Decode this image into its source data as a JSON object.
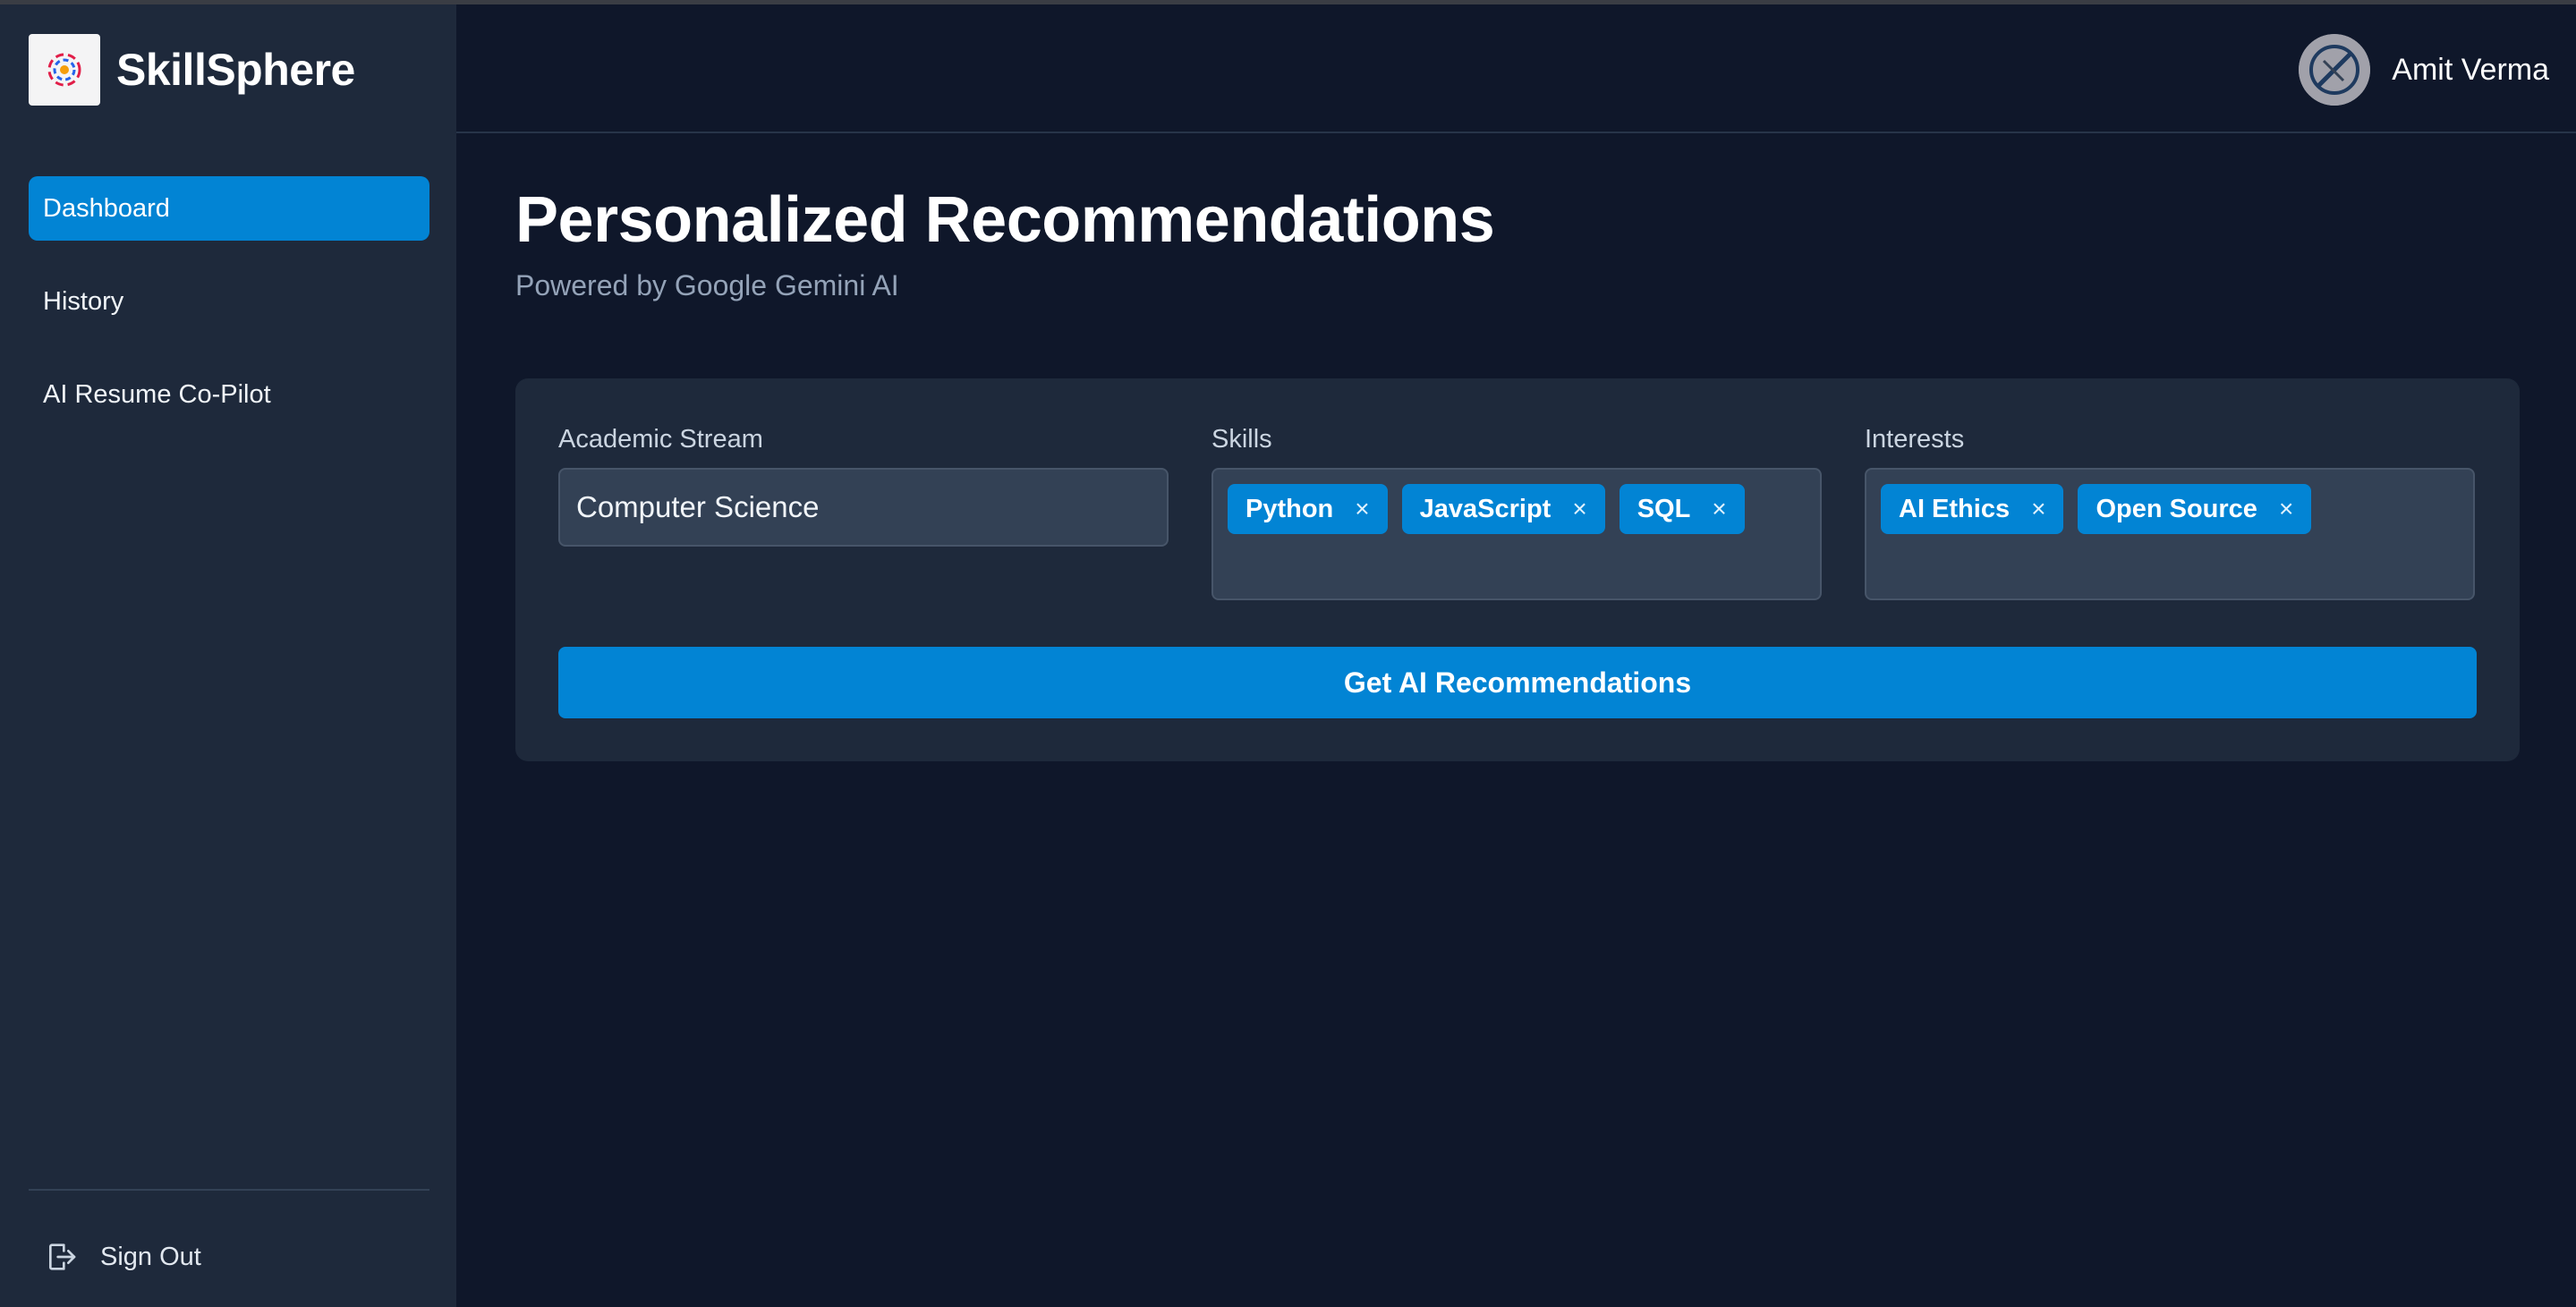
{
  "app": {
    "name": "SkillSphere"
  },
  "sidebar": {
    "items": [
      {
        "label": "Dashboard",
        "active": true
      },
      {
        "label": "History",
        "active": false
      },
      {
        "label": "AI Resume Co-Pilot",
        "active": false
      }
    ],
    "sign_out": {
      "label": "Sign Out",
      "icon": "sign-out-icon"
    }
  },
  "header": {
    "user_name": "Amit Verma"
  },
  "main": {
    "title": "Personalized Recommendations",
    "subtitle": "Powered by Google Gemini AI",
    "form": {
      "academic_stream": {
        "label": "Academic Stream",
        "value": "Computer Science"
      },
      "skills": {
        "label": "Skills",
        "tags": [
          "Python",
          "JavaScript",
          "SQL"
        ]
      },
      "interests": {
        "label": "Interests",
        "tags": [
          "AI Ethics",
          "Open Source"
        ]
      },
      "remove_symbol": "×",
      "submit_label": "Get AI Recommendations"
    }
  },
  "colors": {
    "background": "#0f172a",
    "sidebar": "#1e293b",
    "accent": "#0284d4",
    "input_bg": "#334155",
    "muted_text": "#94a3b8"
  }
}
